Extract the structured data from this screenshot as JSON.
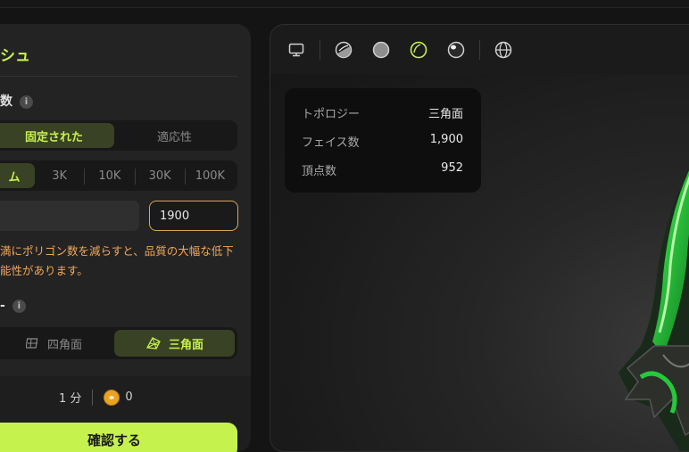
{
  "panel": {
    "title": "シュ",
    "polycount_label": "数",
    "mode_options": [
      "固定された",
      "適応性"
    ],
    "mode_selected": "固定された",
    "preset_options": [
      "ム",
      "3K",
      "10K",
      "30K",
      "100K"
    ],
    "preset_selected": "ム",
    "polycount_value": "1900",
    "warning": "満にポリゴン数を減らすと、品質の大幅な低下\n能性があります。",
    "topology_label": "-",
    "topology_options": [
      "四角面",
      "三角面"
    ],
    "topology_selected": "三角面",
    "cost_time": "1 分",
    "cost_credits": "0",
    "confirm_label": "確認する"
  },
  "viewer": {
    "toolbar_icons": [
      "monitor-icon",
      "half-sphere-icon",
      "solid-sphere-icon",
      "wireframe-sphere-icon",
      "glossy-sphere-icon",
      "globe-icon"
    ],
    "active_icon": "wireframe-sphere-icon",
    "stats": [
      {
        "label": "トポロジー",
        "value": "三角面"
      },
      {
        "label": "フェイス数",
        "value": "1,900"
      },
      {
        "label": "頂点数",
        "value": "952"
      }
    ]
  },
  "colors": {
    "accent": "#c8f050",
    "warning": "#f0a65a",
    "input_border": "#d9a75a",
    "model_green": "#2ecc40"
  }
}
